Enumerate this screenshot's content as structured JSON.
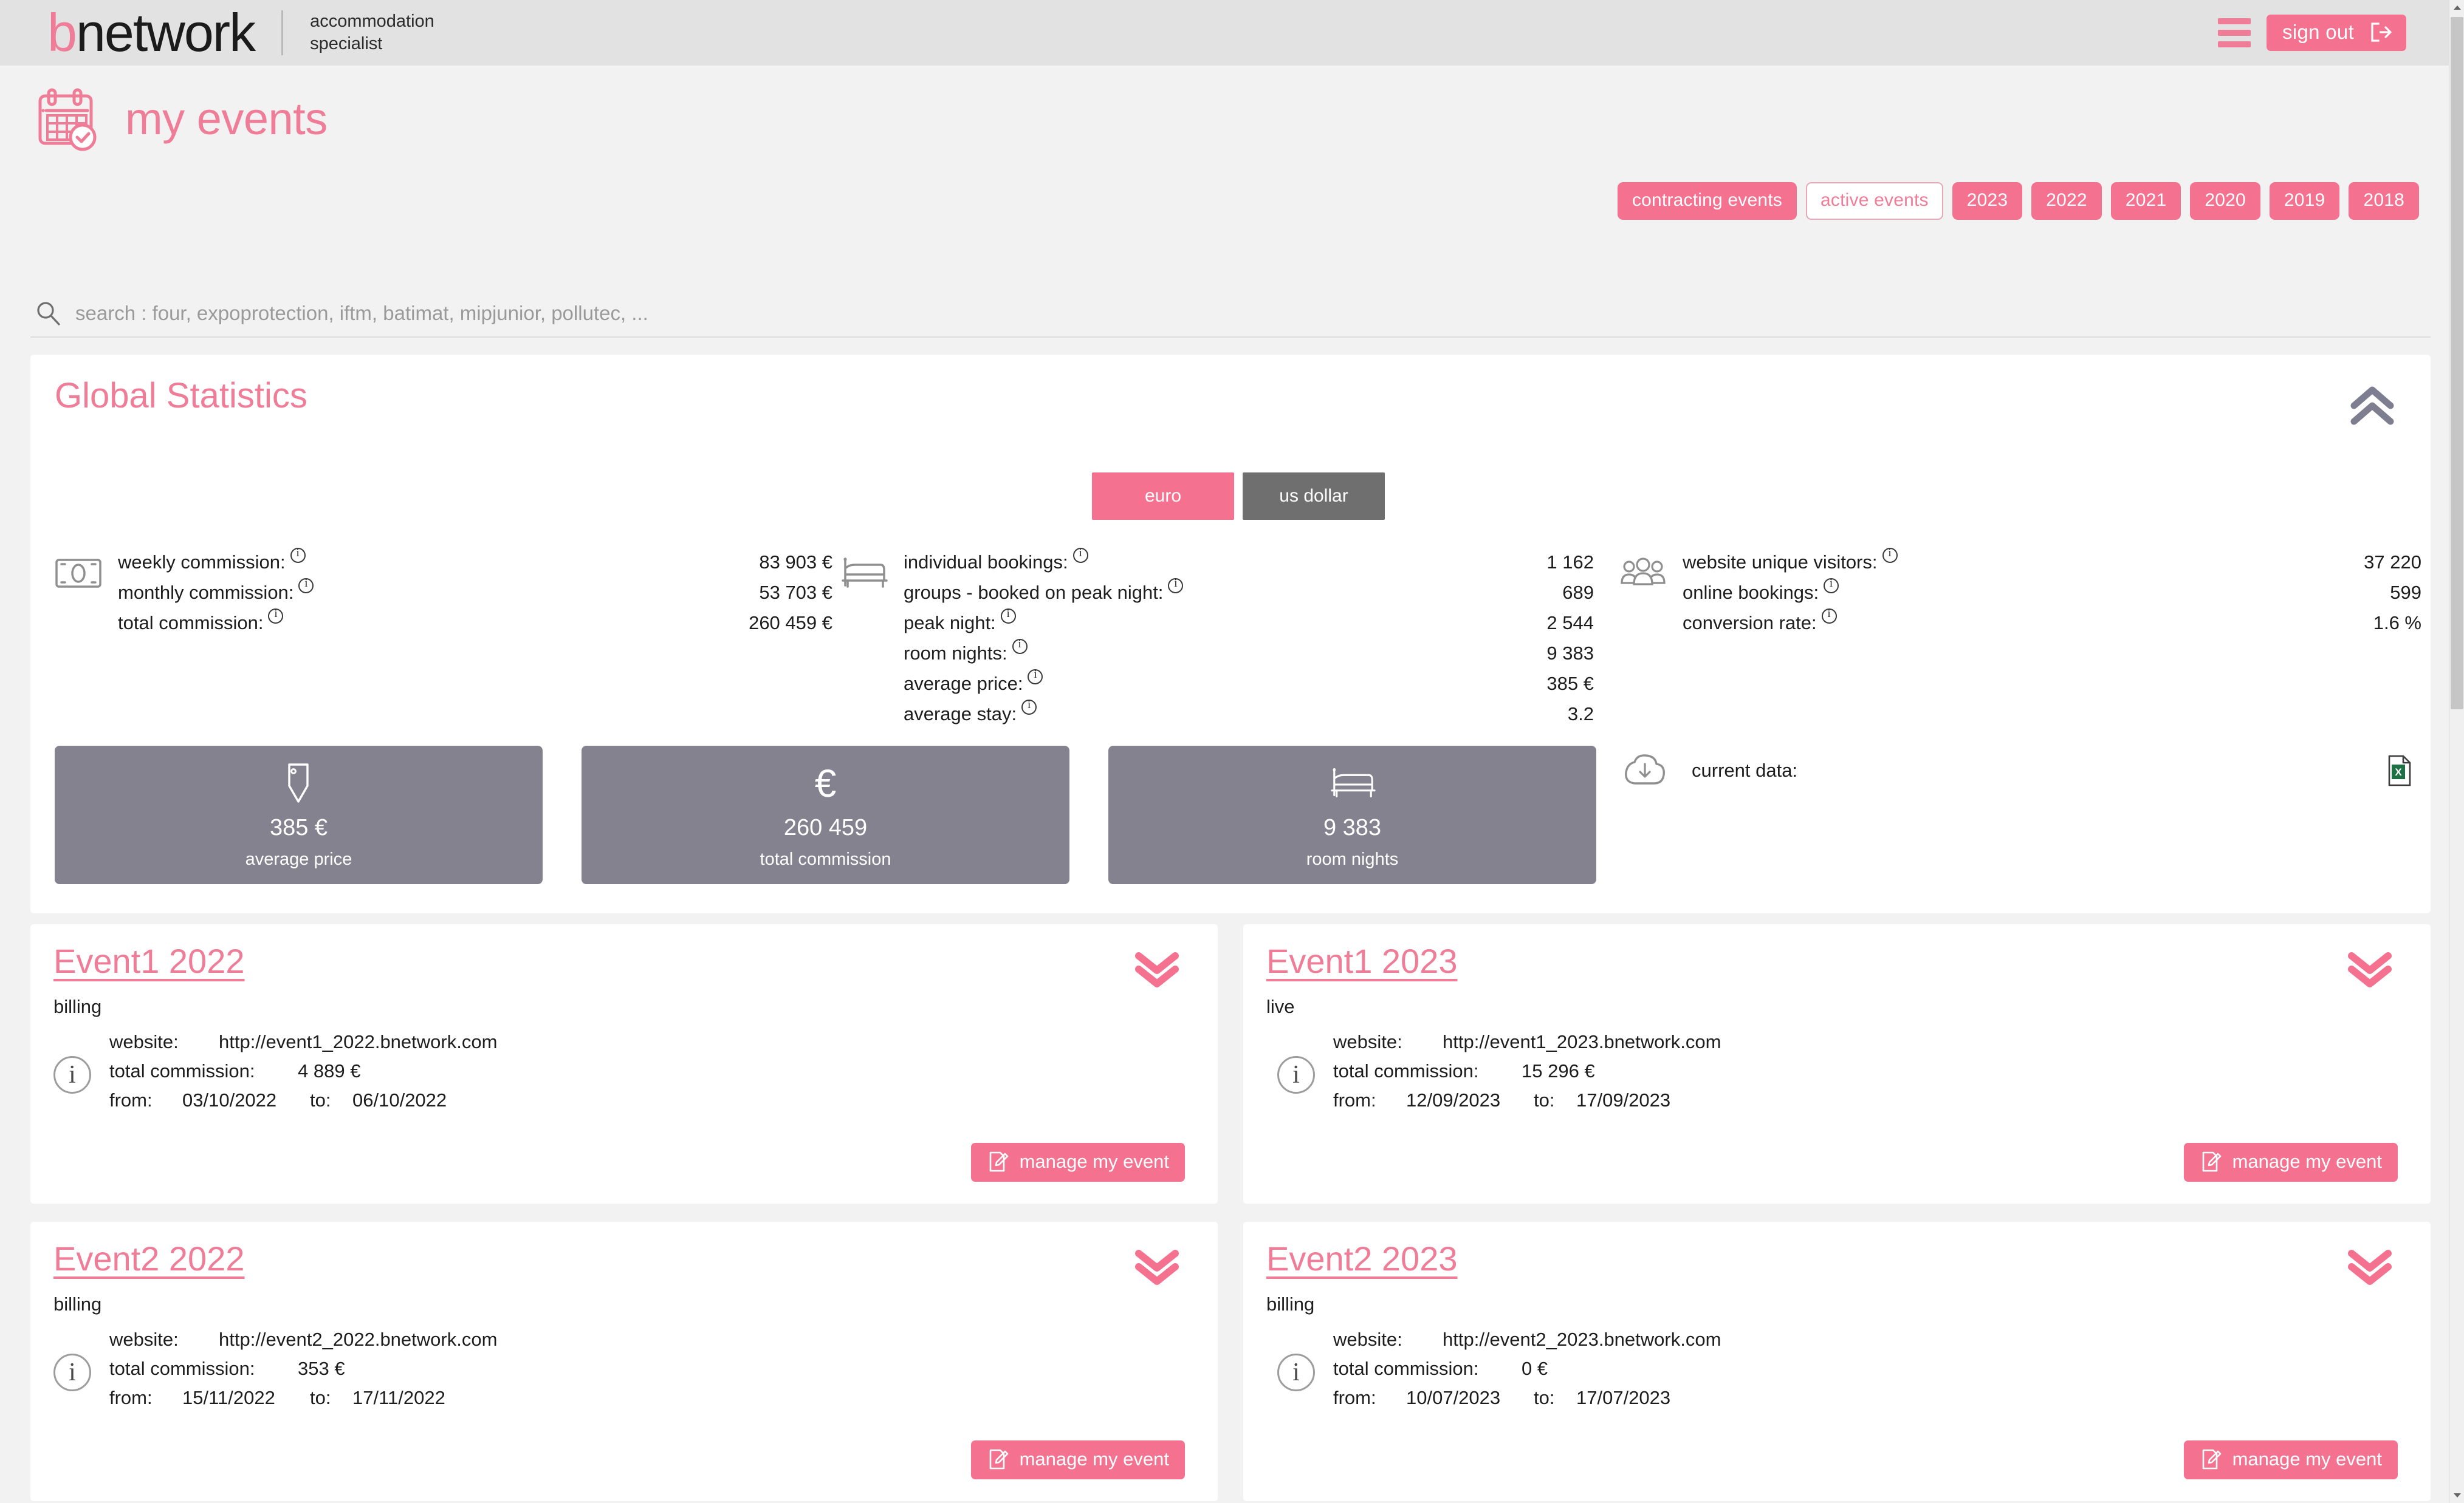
{
  "header": {
    "logo_b": "b",
    "logo_rest": "network",
    "tagline_line1": "accommodation",
    "tagline_line2": "specialist",
    "signout_label": "sign out",
    "menu_icon": "hamburger-menu-icon",
    "signout_icon": "sign-out-icon"
  },
  "page": {
    "title": "my events",
    "title_icon": "calendar-check-icon"
  },
  "filters": [
    {
      "label": "contracting events",
      "active": false
    },
    {
      "label": "active events",
      "active": true
    },
    {
      "label": "2023",
      "active": false
    },
    {
      "label": "2022",
      "active": false
    },
    {
      "label": "2021",
      "active": false
    },
    {
      "label": "2020",
      "active": false
    },
    {
      "label": "2019",
      "active": false
    },
    {
      "label": "2018",
      "active": false
    }
  ],
  "search": {
    "placeholder": "search : four, expoprotection, iftm, batimat, mipjunior, pollutec, ...",
    "value": "",
    "icon": "search-icon"
  },
  "statistics": {
    "title": "Global Statistics",
    "collapse_icon": "double-chevron-up-icon",
    "currency": {
      "euro_label": "euro",
      "usd_label": "us dollar",
      "selected": "euro"
    },
    "columns": [
      {
        "icon": "banknote-icon",
        "rows": [
          {
            "label": "weekly commission:",
            "value": "83 903 €"
          },
          {
            "label": "monthly commission:",
            "value": "53 703 €"
          },
          {
            "label": "total commission:",
            "value": "260 459 €"
          }
        ]
      },
      {
        "icon": "bed-icon",
        "rows": [
          {
            "label": "individual bookings:",
            "value": "1 162"
          },
          {
            "label": "groups - booked on peak night:",
            "value": "689"
          },
          {
            "label": "peak night:",
            "value": "2 544"
          },
          {
            "label": "room nights:",
            "value": "9 383"
          },
          {
            "label": "average price:",
            "value": "385 €"
          },
          {
            "label": "average stay:",
            "value": "3.2"
          }
        ]
      },
      {
        "icon": "people-group-icon",
        "rows": [
          {
            "label": "website unique visitors:",
            "value": "37 220"
          },
          {
            "label": "online bookings:",
            "value": "599"
          },
          {
            "label": "conversion rate:",
            "value": "1.6 %"
          }
        ]
      }
    ],
    "kpis": [
      {
        "icon": "price-tag-icon",
        "value": "385 €",
        "label": "average price"
      },
      {
        "icon": "euro-icon",
        "value": "260 459",
        "label": "total commission"
      },
      {
        "icon": "bed-icon",
        "value": "9 383",
        "label": "room nights"
      }
    ],
    "current_data": {
      "icon": "cloud-download-icon",
      "label": "current data:",
      "export_icon": "excel-file-icon"
    }
  },
  "events": [
    {
      "title": "Event1 2022",
      "status": "billing",
      "chevron_icon": "double-chevron-down-icon",
      "website_key": "website:",
      "website_value": "http://event1_2022.bnetwork.com",
      "commission_key": "total commission:",
      "commission_value": "4 889 €",
      "from_key": "from:",
      "from_value": "03/10/2022",
      "to_key": "to:",
      "to_value": "06/10/2022",
      "manage_label": "manage my event",
      "manage_icon": "edit-document-icon"
    },
    {
      "title": "Event1 2023",
      "status": "live",
      "chevron_icon": "double-chevron-down-icon",
      "website_key": "website:",
      "website_value": "http://event1_2023.bnetwork.com",
      "commission_key": "total commission:",
      "commission_value": "15 296 €",
      "from_key": "from:",
      "from_value": "12/09/2023",
      "to_key": "to:",
      "to_value": "17/09/2023",
      "manage_label": "manage my event",
      "manage_icon": "edit-document-icon"
    },
    {
      "title": "Event2 2022",
      "status": "billing",
      "chevron_icon": "double-chevron-down-icon",
      "website_key": "website:",
      "website_value": "http://event2_2022.bnetwork.com",
      "commission_key": "total commission:",
      "commission_value": "353 €",
      "from_key": "from:",
      "from_value": "15/11/2022",
      "to_key": "to:",
      "to_value": "17/11/2022",
      "manage_label": "manage my event",
      "manage_icon": "edit-document-icon"
    },
    {
      "title": "Event2 2023",
      "status": "billing",
      "chevron_icon": "double-chevron-down-icon",
      "website_key": "website:",
      "website_value": "http://event2_2023.bnetwork.com",
      "commission_key": "total commission:",
      "commission_value": "0 €",
      "from_key": "from:",
      "from_value": "10/07/2023",
      "to_key": "to:",
      "to_value": "17/07/2023",
      "manage_label": "manage my event",
      "manage_icon": "edit-document-icon"
    }
  ],
  "colors": {
    "brand_pink": "#ef7d98",
    "button_pink": "#f4728f",
    "kpi_gray": "#85828f",
    "toggle_gray": "#6f6f6f",
    "excel_green": "#1e7145"
  }
}
